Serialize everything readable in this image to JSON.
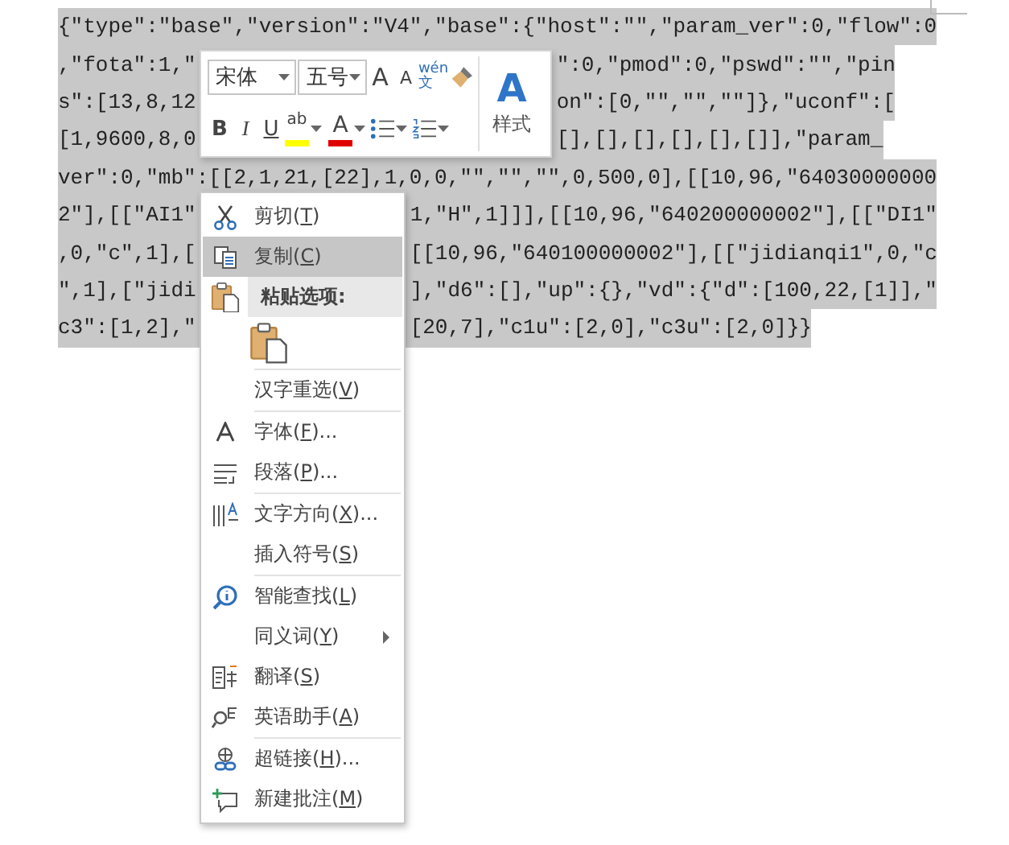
{
  "document": {
    "lines": [
      {
        "kind": "full",
        "selected": true,
        "left": "{\"type\":\"base\",\"version\":\"V4\",\"base\":{\"host\":\"\",\"param_ver\":0,\"flow\":0"
      },
      {
        "kind": "toolbar-gap",
        "selected": true,
        "left": ",\"fota\":1,\"",
        "right": "\":0,\"pmod\":0,\"pswd\":\"\",\"pin"
      },
      {
        "kind": "toolbar-gap",
        "selected": true,
        "left": "s\":[13,8,12",
        "right": "on\":[0,\"\",\"\",\"\"]},\"uconf\":["
      },
      {
        "kind": "toolbar-gap",
        "selected": true,
        "left": "[1,9600,8,0",
        "right": "[],[],[],[],[],[]],\"param_"
      },
      {
        "kind": "full",
        "selected": true,
        "left": "ver\":0,\"mb\":[[2,1,21,[22],1,0,0,\"\",\"\",\"\",0,500,0],[[10,96,\"64030000000"
      },
      {
        "kind": "menu-gap",
        "selected": true,
        "left": "2\"],[[\"AI1\"",
        "right": "1,\"H\",1]]],[[10,96,\"640200000002\"],[[\"DI1\""
      },
      {
        "kind": "menu-gap",
        "selected": true,
        "left": ",0,\"c\",1],[",
        "right": "[[10,96,\"640100000002\"],[[\"jidianqi1\",0,\"c"
      },
      {
        "kind": "menu-gap",
        "selected": true,
        "left": "\",1],[\"jidi",
        "right": "],\"d6\":[],\"up\":{},\"vd\":{\"d\":[100,22,[1]],\""
      },
      {
        "kind": "menu-gap",
        "selected": true,
        "left": "c3\":[1,2],\"",
        "right": "[20,7],\"c1u\":[2,0],\"c3u\":[2,0]}}"
      }
    ]
  },
  "mini_toolbar": {
    "font": "宋体",
    "size": "五号",
    "grow": "A",
    "shrink": "A",
    "phonetic_top": "wén",
    "phonetic_bottom": "文",
    "bold": "B",
    "italic": "I",
    "underline": "U",
    "highlight": "ab",
    "font_color": "A",
    "style_letter": "A",
    "style_label": "样式"
  },
  "context_menu": [
    {
      "kind": "item",
      "label_parts": [
        "剪切(",
        "T",
        ")"
      ],
      "selected": false,
      "submenu": false
    },
    {
      "kind": "item",
      "label_parts": [
        "复制(",
        "C",
        ")"
      ],
      "selected": true,
      "submenu": false
    },
    {
      "kind": "header",
      "label": "粘贴选项:"
    },
    {
      "kind": "paste-option"
    },
    {
      "kind": "separator"
    },
    {
      "kind": "item",
      "label_parts": [
        "汉字重选(",
        "V",
        ")"
      ],
      "selected": false,
      "submenu": false
    },
    {
      "kind": "separator"
    },
    {
      "kind": "item",
      "label_parts": [
        "字体(",
        "F",
        ")..."
      ],
      "selected": false,
      "submenu": false
    },
    {
      "kind": "item",
      "label_parts": [
        "段落(",
        "P",
        ")..."
      ],
      "selected": false,
      "submenu": false
    },
    {
      "kind": "separator"
    },
    {
      "kind": "item",
      "label_parts": [
        "文字方向(",
        "X",
        ")..."
      ],
      "selected": false,
      "submenu": false
    },
    {
      "kind": "item",
      "label_parts": [
        "插入符号(",
        "S",
        ")"
      ],
      "selected": false,
      "submenu": false
    },
    {
      "kind": "separator"
    },
    {
      "kind": "item",
      "label_parts": [
        "智能查找(",
        "L",
        ")"
      ],
      "selected": false,
      "submenu": false
    },
    {
      "kind": "item",
      "label_parts": [
        "同义词(",
        "Y",
        ")"
      ],
      "selected": false,
      "submenu": true
    },
    {
      "kind": "item",
      "label_parts": [
        "翻译(",
        "S",
        ")"
      ],
      "selected": false,
      "submenu": false
    },
    {
      "kind": "item",
      "label_parts": [
        "英语助手(",
        "A",
        ")"
      ],
      "selected": false,
      "submenu": false
    },
    {
      "kind": "separator"
    },
    {
      "kind": "item",
      "label_parts": [
        "超链接(",
        "H",
        ")..."
      ],
      "selected": false,
      "submenu": false
    },
    {
      "kind": "item",
      "label_parts": [
        "新建批注(",
        "M",
        ")"
      ],
      "selected": false,
      "submenu": false
    }
  ]
}
